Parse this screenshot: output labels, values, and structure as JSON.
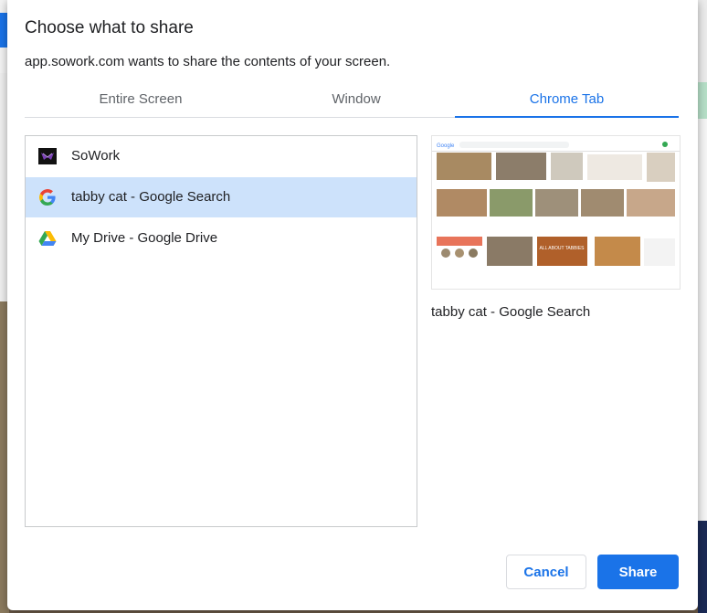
{
  "dialog": {
    "title": "Choose what to share",
    "subtitle": "app.sowork.com wants to share the contents of your screen."
  },
  "tabs": [
    {
      "label": "Entire Screen",
      "selected": false
    },
    {
      "label": "Window",
      "selected": false
    },
    {
      "label": "Chrome Tab",
      "selected": true
    }
  ],
  "tab_list": [
    {
      "label": "SoWork",
      "icon": "sowork-icon",
      "selected": false
    },
    {
      "label": "tabby cat - Google Search",
      "icon": "google-icon",
      "selected": true
    },
    {
      "label": "My Drive - Google Drive",
      "icon": "google-drive-icon",
      "selected": false
    }
  ],
  "preview": {
    "caption": "tabby cat - Google Search",
    "thumbnail_text": [
      "Google",
      "ALL ABOUT TABBIES"
    ]
  },
  "buttons": {
    "cancel": "Cancel",
    "share": "Share"
  },
  "colors": {
    "accent": "#1a73e8",
    "selected_row": "#cde2fb"
  }
}
